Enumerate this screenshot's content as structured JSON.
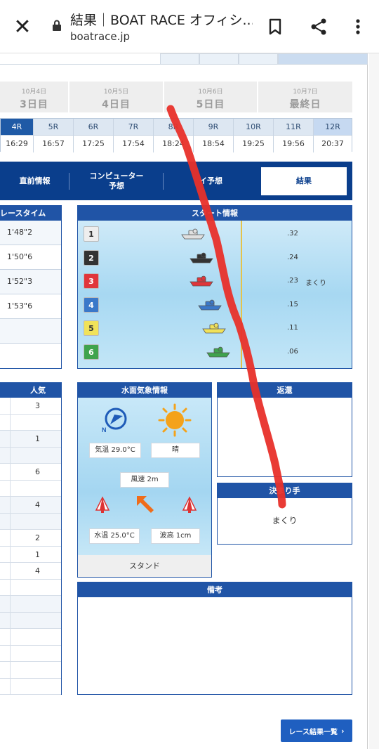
{
  "browser": {
    "title": "結果｜BOAT RACE オフィシ...",
    "url": "boatrace.jp"
  },
  "days": [
    {
      "date": "10月4日",
      "label": "3日目"
    },
    {
      "date": "10月5日",
      "label": "4日目"
    },
    {
      "date": "10月6日",
      "label": "5日目"
    },
    {
      "date": "10月7日",
      "label": "最終日"
    }
  ],
  "races": [
    {
      "no": "4R",
      "time": "16:29"
    },
    {
      "no": "5R",
      "time": "16:57"
    },
    {
      "no": "6R",
      "time": "17:25"
    },
    {
      "no": "7R",
      "time": "17:54"
    },
    {
      "no": "8R",
      "time": "18:24"
    },
    {
      "no": "9R",
      "time": "18:54"
    },
    {
      "no": "10R",
      "time": "19:25"
    },
    {
      "no": "11R",
      "time": "19:56"
    },
    {
      "no": "12R",
      "time": "20:37"
    }
  ],
  "nav": {
    "before": "直前情報",
    "computer": "コンピューター",
    "computer_sub": "予想",
    "ai": "イ予想",
    "result": "結果"
  },
  "racetime": {
    "header": "レースタイム",
    "rows": [
      "1'48\"2",
      "1'50\"6",
      "1'52\"3",
      "1'53\"6",
      "",
      ""
    ]
  },
  "start_info": {
    "header": "スタート情報",
    "lanes": [
      {
        "no": "1",
        "st": ".32",
        "note": "",
        "color": "#eeeeee",
        "text": "#333",
        "boat": "#e0e0e0"
      },
      {
        "no": "2",
        "st": ".24",
        "note": "",
        "color": "#333333",
        "text": "#fff",
        "boat": "#333333"
      },
      {
        "no": "3",
        "st": ".23",
        "note": "まくり",
        "color": "#e0353a",
        "text": "#fff",
        "boat": "#e0353a"
      },
      {
        "no": "4",
        "st": ".15",
        "note": "",
        "color": "#3a78c9",
        "text": "#fff",
        "boat": "#3a78c9"
      },
      {
        "no": "5",
        "st": ".11",
        "note": "",
        "color": "#f1e25a",
        "text": "#333",
        "boat": "#f1e25a"
      },
      {
        "no": "6",
        "st": ".06",
        "note": "",
        "color": "#3fa34d",
        "text": "#fff",
        "boat": "#3fa34d"
      }
    ]
  },
  "ninki": {
    "header": "人気",
    "rows": [
      "3",
      "",
      "1",
      "",
      "6",
      "",
      "4",
      "",
      "2",
      "1",
      "4",
      "",
      "",
      "",
      "",
      "",
      "",
      ""
    ]
  },
  "weather": {
    "header": "水面気象情報",
    "kion": "気温 29.0°C",
    "tenki": "晴",
    "fusoku": "風速 2m",
    "suion": "水温 25.0°C",
    "hakou": "波高 1cm",
    "stand": "スタンド",
    "north": "N"
  },
  "henkan": {
    "header": "返還"
  },
  "kimarite": {
    "header": "決まり手",
    "value": "まくり"
  },
  "biko": {
    "header": "備考"
  },
  "results_button": "レース結果一覧"
}
